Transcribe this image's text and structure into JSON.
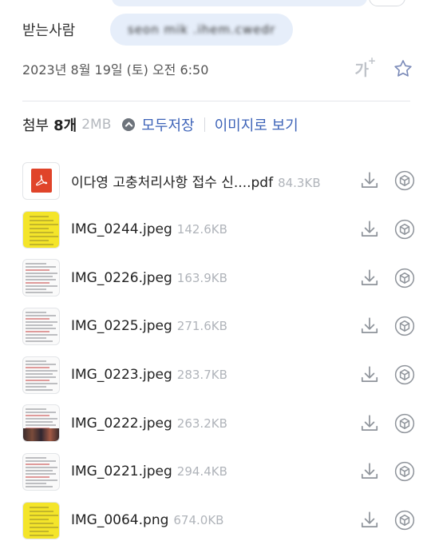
{
  "recipient": {
    "label": "받는사람",
    "address": "seon mik .ihem.cwedr"
  },
  "meta": {
    "date": "2023년 8월 19일 (토) 오전 6:50",
    "font_size_label": "가",
    "font_size_sup": "+"
  },
  "attachments": {
    "title": "첨부",
    "count": "8개",
    "total_size": "2MB",
    "save_all_label": "모두저장",
    "view_images_label": "이미지로 보기",
    "files": [
      {
        "name": "이다영 고충처리사항 접수 신....pdf",
        "size": "84.3KB",
        "thumb": "pdf"
      },
      {
        "name": "IMG_0244.jpeg",
        "size": "142.6KB",
        "thumb": "yellow"
      },
      {
        "name": "IMG_0226.jpeg",
        "size": "163.9KB",
        "thumb": "doc"
      },
      {
        "name": "IMG_0225.jpeg",
        "size": "271.6KB",
        "thumb": "doc"
      },
      {
        "name": "IMG_0223.jpeg",
        "size": "283.7KB",
        "thumb": "doc"
      },
      {
        "name": "IMG_0222.jpeg",
        "size": "263.2KB",
        "thumb": "photo"
      },
      {
        "name": "IMG_0221.jpeg",
        "size": "294.4KB",
        "thumb": "doc"
      },
      {
        "name": "IMG_0064.png",
        "size": "674.0KB",
        "thumb": "yellow"
      }
    ]
  },
  "icons": {
    "download": "download-icon",
    "save_to_cloud": "cube-icon",
    "star": "star-icon",
    "chevron": "chevron-up-icon"
  },
  "colors": {
    "accent": "#3d63b8",
    "chip": "#e6eefa",
    "pdf": "#e0442a",
    "muted": "#b0b4ba"
  }
}
